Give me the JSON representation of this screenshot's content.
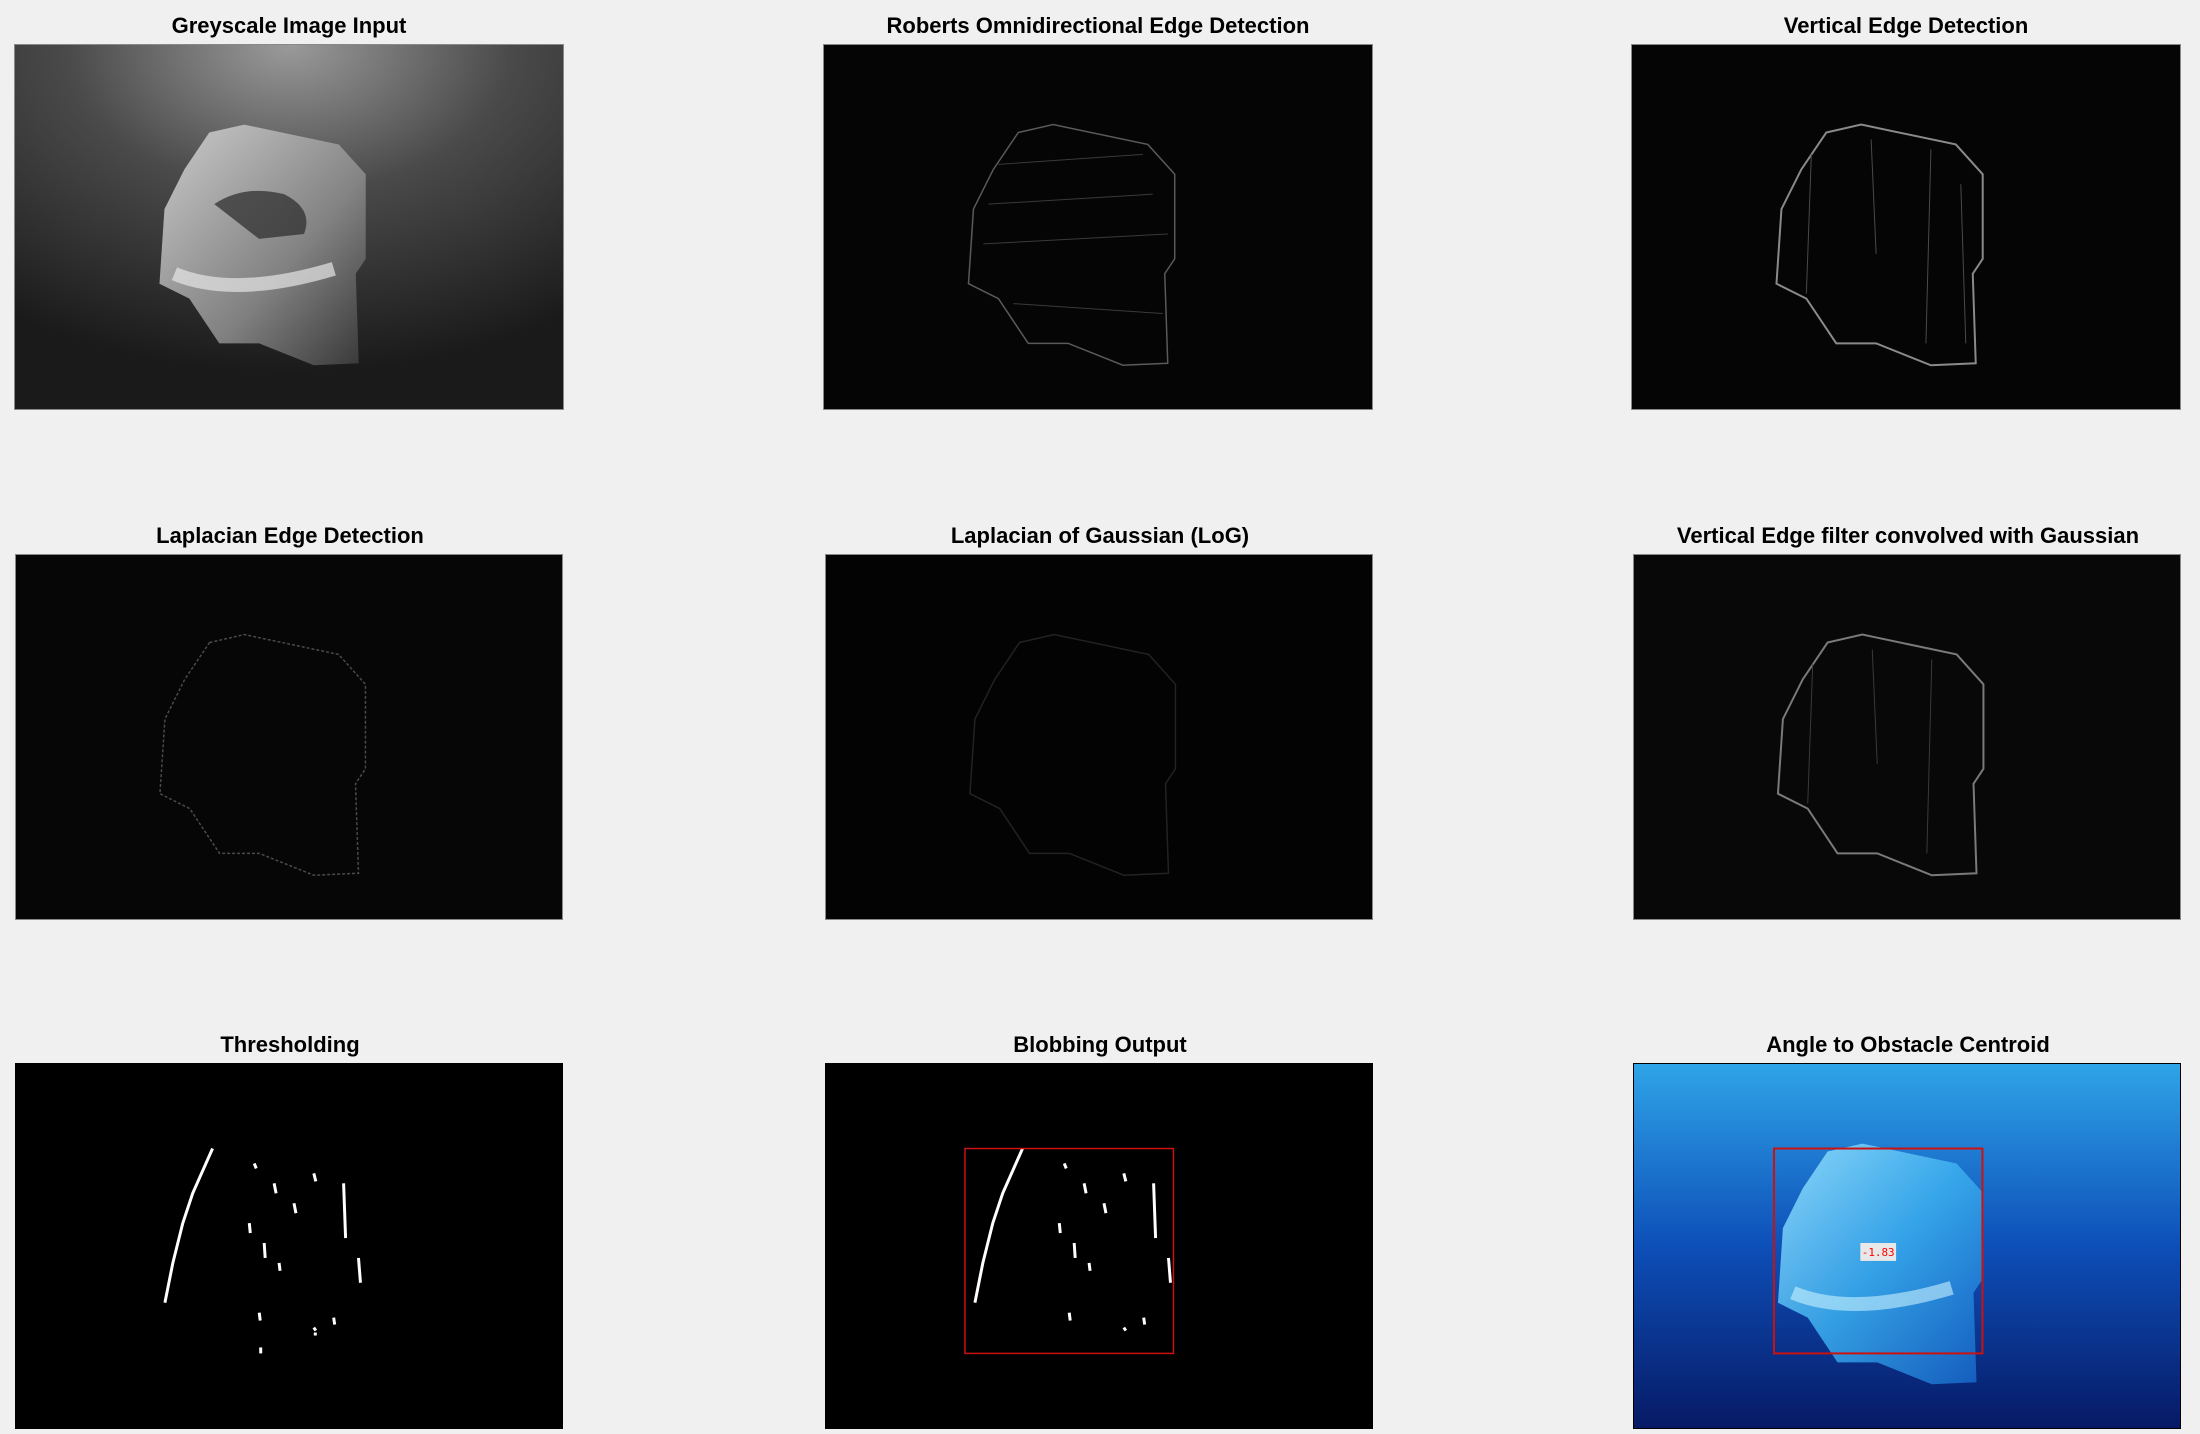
{
  "figure": {
    "panels": [
      {
        "title": "Greyscale Image Input",
        "image": "greyscale-input"
      },
      {
        "title": "Roberts Omnidirectional Edge Detection",
        "image": "roberts-edges"
      },
      {
        "title": "Vertical Edge Detection",
        "image": "vertical-edges"
      },
      {
        "title": "Laplacian Edge Detection",
        "image": "laplacian-edges"
      },
      {
        "title": "Laplacian of Gaussian (LoG)",
        "image": "log-edges"
      },
      {
        "title": "Vertical Edge filter convolved with Gaussian",
        "image": "vertical-gaussian-edges"
      },
      {
        "title": "Thresholding",
        "image": "threshold-binary"
      },
      {
        "title": "Blobbing Output",
        "image": "blob-binary"
      },
      {
        "title": "Angle to Obstacle Centroid",
        "image": "color-underwater",
        "angle_label": "-1.83"
      }
    ],
    "colors": {
      "background": "#f0f0f0",
      "bounding_box": "#cc1111",
      "angle_text": "#ff0000",
      "water_light": "#2fa4e8",
      "water_dark": "#071a66"
    }
  }
}
